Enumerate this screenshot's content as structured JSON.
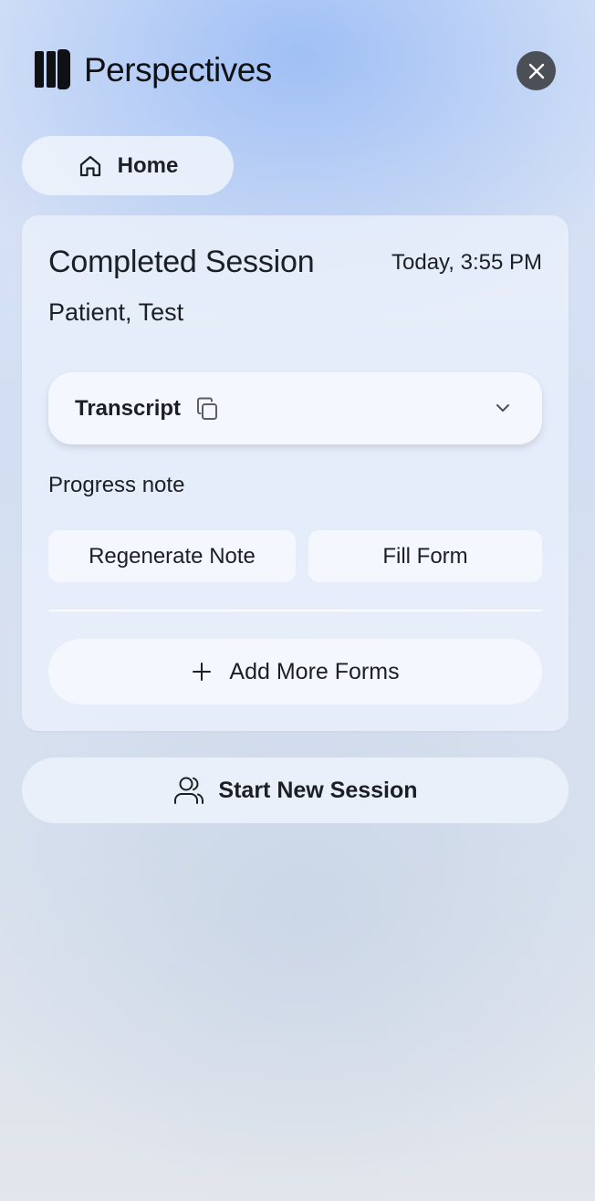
{
  "header": {
    "app_name": "Perspectives",
    "logo_icon": "perspectives-logo-icon",
    "close_icon": "close-icon"
  },
  "nav": {
    "home_label": "Home",
    "home_icon": "home-icon"
  },
  "session": {
    "title": "Completed Session",
    "timestamp": "Today, 3:55 PM",
    "patient": "Patient, Test",
    "transcript": {
      "label": "Transcript",
      "copy_icon": "copy-icon",
      "expand_icon": "chevron-down-icon"
    },
    "progress_note_label": "Progress note",
    "actions": {
      "regenerate_label": "Regenerate Note",
      "fill_form_label": "Fill Form"
    },
    "add_forms": {
      "label": "Add More Forms",
      "icon": "plus-icon"
    }
  },
  "footer": {
    "start_new_label": "Start New Session",
    "start_new_icon": "users-icon"
  },
  "colors": {
    "close_button_bg": "#4b4f56",
    "text": "#1c1f24",
    "accent_gradient": "#96b9f5"
  }
}
